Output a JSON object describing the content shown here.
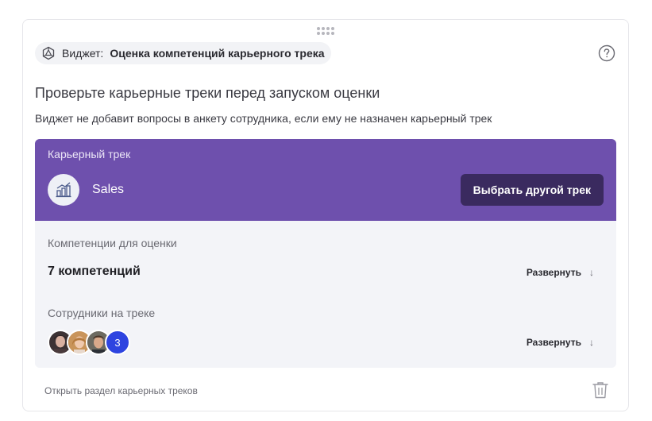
{
  "widget": {
    "prefix": "Виджет:",
    "name": "Оценка компетенций карьерного трека"
  },
  "title": "Проверьте карьерные треки перед запуском оценки",
  "subtitle": "Виджет не добавит вопросы в анкету сотрудника, если ему не назначен карьерный трек",
  "track": {
    "label": "Карьерный трек",
    "name": "Sales",
    "change_button": "Выбрать другой трек"
  },
  "competencies": {
    "label": "Компетенции для оценки",
    "count_text": "7 компетенций",
    "expand_label": "Развернуть"
  },
  "employees": {
    "label": "Сотрудники на треке",
    "extra_count": "3",
    "expand_label": "Развернуть"
  },
  "footer": {
    "link": "Открыть раздел карьерных треков"
  },
  "icons": {
    "arrow": "↓"
  },
  "colors": {
    "track_header": "#6e50ad",
    "button_dark": "#3a2a5f",
    "count_badge": "#2e44e0"
  }
}
